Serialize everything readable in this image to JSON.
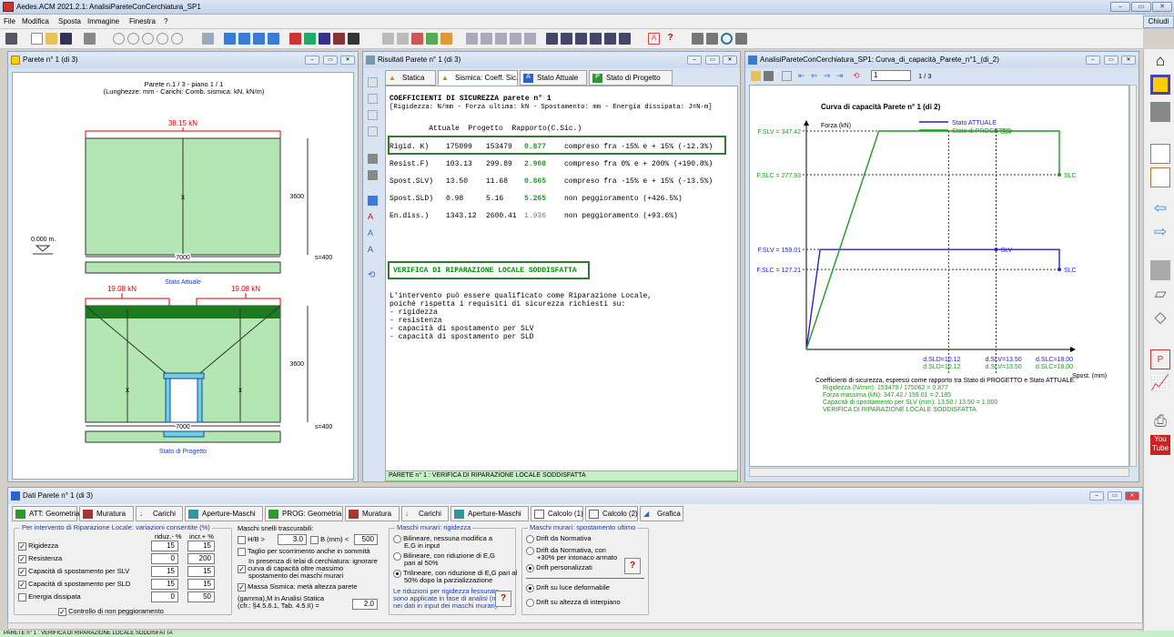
{
  "app": {
    "title": "Aedes.ACM 2021.2.1: AnalisiPareteConCerchiatura_SP1",
    "close_label": "Chiudi"
  },
  "menu": [
    "File",
    "Modifica",
    "Sposta",
    "Immagine",
    "Finestra",
    "?"
  ],
  "left_window": {
    "title": "Parete n° 1 (di 3)",
    "header_line1": "Parete n.1 / 3 - piano 1 / 1",
    "header_line2": "(Lunghezze: mm - Carichi: Comb. sismica: kN, kN/m)",
    "top_load": "38.15 kN",
    "height_top": "3600",
    "width_top": "7000",
    "s_top": "s=400",
    "level": "0.000 m.",
    "caption_top": "Stato Attuale",
    "load_left": "19.08 kN",
    "load_right": "19.08 kN",
    "height_bottom": "3600",
    "width_bottom": "7000",
    "s_bottom": "s=400",
    "caption_bottom": "Stato di Progetto"
  },
  "mid_window": {
    "title": "Risultati Parete n° 1 (di 3)",
    "tabs": [
      "Statica",
      "Sismica: Coeff. Sic.",
      "Stato Attuale",
      "Stato di Progetto"
    ],
    "heading": "COEFFICIENTI DI SICUREZZA parete n° 1",
    "units": "[Rigidezza: N/mm - Forza ultima: kN - Spostamento: mm - Energia dissipata: J=N·m]",
    "col_headers": "         Attuale  Progetto  Rapporto(C.Sic.)",
    "rows": [
      {
        "name": "Rigid. K)",
        "att": "175099",
        "prog": "153479",
        "ratio": "0.877",
        "note": "compreso fra -15% e + 15% (-12.3%)"
      },
      {
        "name": "Resist.F)",
        "att": "103.13",
        "prog": "299.89",
        "ratio": "2.908",
        "note": "compreso fra 0% e + 200% (+190.8%)"
      },
      {
        "name": "Spost.SLV)",
        "att": "13.50",
        "prog": "11.68",
        "ratio": "0.865",
        "note": "compreso fra -15% e + 15% (-13.5%)"
      },
      {
        "name": "Spost.SLD)",
        "att": "0.98",
        "prog": "5.16",
        "ratio": "5.265",
        "note": "non peggioramento (+426.5%)"
      },
      {
        "name": "En.diss.)",
        "att": "1343.12",
        "prog": "2600.41",
        "ratio": "1.936",
        "note": "non peggioramento (+93.6%)"
      }
    ],
    "verdict": "VERIFICA DI RIPARAZIONE LOCALE SODDISFATTA",
    "text": [
      "L'intervento può essere qualificato come Riparazione Locale,",
      "poiché rispetta i requisiti di sicurezza richiesti su:",
      "- rigidezza",
      "- resistenza",
      "- capacità di spostamento per SLV",
      "- capacità di spostamento per SLD"
    ],
    "status": "PARETE n° 1 : VERIFICA DI RIPARAZIONE LOCALE SODDISFATTA"
  },
  "right_window": {
    "title": "AnalisiPareteConCerchiatura_SP1: Curva_di_capacità_Parete_n°1_(di_2)",
    "page_input": "1",
    "page_of": "1 / 3"
  },
  "chart_data": {
    "type": "line",
    "title": "Curva di capacità Parete n° 1 (di 2)",
    "ylabel": "Forza (kN)",
    "xlabel": "Spost. (mm)",
    "legend": [
      "Stato ATTUALE",
      "Stato di PROGETTO"
    ],
    "legend_position": "top-right",
    "colors": {
      "attuale": "#2424c8",
      "progetto": "#1e9a1e"
    },
    "series": [
      {
        "name": "Stato ATTUALE",
        "points": [
          [
            0,
            0
          ],
          [
            0.98,
            159.01
          ],
          [
            13.5,
            159.01
          ],
          [
            18,
            159.01
          ],
          [
            18,
            127.21
          ]
        ]
      },
      {
        "name": "Stato di PROGETTO",
        "points": [
          [
            0,
            0
          ],
          [
            5.16,
            347.42
          ],
          [
            11.68,
            347.42
          ],
          [
            18,
            347.42
          ],
          [
            18,
            277.93
          ]
        ]
      }
    ],
    "y_labels": [
      {
        "text": "F.SLV = 347.42",
        "value": 347.42,
        "color": "#1e9a1e"
      },
      {
        "text": "F.SLC = 277.93",
        "value": 277.93,
        "color": "#1e9a1e"
      },
      {
        "text": "F.SLV = 159.01",
        "value": 159.01,
        "color": "#2424c8"
      },
      {
        "text": "F.SLC = 127.21",
        "value": 127.21,
        "color": "#2424c8"
      }
    ],
    "point_labels": [
      {
        "text": "SLV",
        "x": 13.5,
        "y": 347.42,
        "color": "#1e9a1e"
      },
      {
        "text": "SLC",
        "x": 18,
        "y": 277.93,
        "color": "#1e9a1e"
      },
      {
        "text": "SLV",
        "x": 13.5,
        "y": 159.01,
        "color": "#2424c8"
      },
      {
        "text": "SLC",
        "x": 18,
        "y": 127.21,
        "color": "#2424c8"
      }
    ],
    "x_labels": [
      {
        "text": "d.SLD=10.12",
        "row": 1,
        "color": "#2424c8"
      },
      {
        "text": "d.SLV=13.50",
        "row": 1,
        "color": "#2424c8"
      },
      {
        "text": "d.SLC=18.00",
        "row": 1,
        "color": "#2424c8"
      },
      {
        "text": "d.SLD=10.12",
        "row": 2,
        "color": "#1e9a1e"
      },
      {
        "text": "d.SLV=13.50",
        "row": 2,
        "color": "#1e9a1e"
      },
      {
        "text": "d.SLC=18.00",
        "row": 2,
        "color": "#1e9a1e"
      }
    ],
    "summary": [
      {
        "text": "Coefficienti di sicurezza, espressi come rapporto tra Stato di PROGETTO e Stato ATTUALE:",
        "color": "#000000"
      },
      {
        "text": "Rigidezza (N/mm): 153479 / 175062 = 0.877",
        "color": "#1e9a1e"
      },
      {
        "text": "Forza massima (kN): 347.42 / 159.01 = 2.185",
        "color": "#1e9a1e"
      },
      {
        "text": "Capacità di spostamento per SLV (mm): 13.50 / 13.50 = 1.000",
        "color": "#1e9a1e"
      },
      {
        "text": "VERIFICA DI RIPARAZIONE LOCALE SODDISFATTA",
        "color": "#1e9a1e"
      }
    ]
  },
  "bottom_window": {
    "title": "Dati Parete n° 1 (di 3)",
    "tabs": [
      "ATT: Geometria",
      "Muratura",
      "Carichi",
      "Aperture-Maschi",
      "PROG: Geometria",
      "Muratura",
      "Carichi",
      "Aperture-Maschi",
      "Calcolo (1)",
      "Calcolo (2)",
      "Grafica"
    ],
    "group1": {
      "title": "Per intervento di Riparazione Locale: variazioni consentite (%)",
      "col1": "riduz.- %",
      "col2": "incr.+ %",
      "rows": [
        {
          "label": "Rigidezza",
          "checked": "✓",
          "a": "15",
          "b": "15"
        },
        {
          "label": "Resistenza",
          "checked": "✓",
          "a": "0",
          "b": "200"
        },
        {
          "label": "Capacità di spostamento per SLV",
          "checked": "✓",
          "a": "15",
          "b": "15"
        },
        {
          "label": "Capacità di spostamento per SLD",
          "checked": "✓",
          "a": "15",
          "b": "15"
        },
        {
          "label": "Energia dissipata",
          "checked": "",
          "a": "0",
          "b": "50"
        }
      ],
      "control": "Controllo di non peggioramento"
    },
    "group2": {
      "title": "Maschi snelli trascurabili:",
      "hb": "H/B >",
      "hb_val": "3.0",
      "bmm": "B (mm) <",
      "bmm_val": "500",
      "taglio": "Taglio per scorrimento anche in sommità",
      "telai": "In presenza di telai di cerchiatura: ignorare",
      "curva": "curva di capacità oltre massimo",
      "curva2": "spostamento dei maschi murari",
      "massa": "Massa Sismica: metà altezza parete",
      "gamma": "(gamma),M in Analisi Statica",
      "gamma2": "(cfr.: §4.5.6.1, Tab. 4.5.II) =",
      "gamma_val": "2.0"
    },
    "group3": {
      "title": "Maschi murari: rigidezza",
      "o1": "Bilineare, nessuna modifica a",
      "o1b": "E,G in input",
      "o2": "Bilineare, con riduzione di E,G",
      "o2b": "pari al 50%",
      "o3": "Trilineare, con riduzione di E,G pari al",
      "o3b": "50% dopo la parzializzazione",
      "note": "Le riduzioni per rigidezza fessurata",
      "note2": "sono applicate in fase di analisi (non",
      "note3": "nei dati in input dei maschi murari)"
    },
    "group4": {
      "title": "Maschi murari: spostamento ultimo",
      "o1": "Drift da Normativa",
      "o2": "Drift da Normativa, con",
      "o2b": "+30% per intonaco armato",
      "o3": "Drift personalizzati",
      "o4": "Drift su luce deformabile",
      "o5": "Drift su altezza di interpiano"
    }
  },
  "status_bar": "PARETE n° 1 : VERIFICA DI RIPARAZIONE LOCALE SODDISFATTA"
}
